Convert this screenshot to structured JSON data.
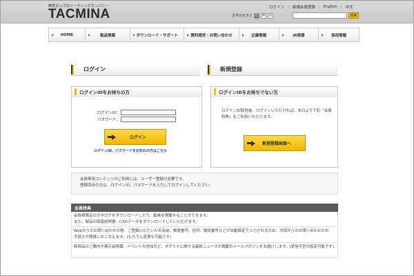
{
  "header": {
    "logo_sub": "精密ポンプのリーディングカンパニー",
    "logo": "TACMINA",
    "top_links": [
      "ログイン",
      "新規会員登録",
      "English",
      "中文"
    ],
    "font_size_label": "文字の大きさ",
    "font_sizes": [
      "小",
      "中",
      "大"
    ],
    "search_button": "検索"
  },
  "nav": [
    "HOME",
    "製品情報",
    "ダウンロード・サポート",
    "資料請求・お問い合わせ",
    "企業情報",
    "IR情報",
    "採用情報"
  ],
  "login": {
    "section_title": "ログイン",
    "panel_title": "ログインIDをお持ちの方",
    "id_label": "ログインID：",
    "password_label": "パスワード：",
    "button": "ログイン",
    "forgot": "ログインID、パスワードをお忘れの方はこちら"
  },
  "register": {
    "section_title": "新規登録",
    "panel_title": "ログインIDをお持ちでない方",
    "text": "ログインID取得後、ログインいただければ、本日より下記「会員特典」をご利用いただけます。",
    "button": "新規登録画面へ"
  },
  "info": {
    "line1": "会員専用コンテンツのご利用には、ユーザー登録が必要です。",
    "line2": "登録済みの方は、ログインID、パスワードを入力してログインしてください。"
  },
  "perks": {
    "title": "会員特典",
    "row1a": "会員様限定のカタログをダウンロードしたり、動画を視聴することができます。",
    "row1b": "また、製品の取扱説明書、CADデータをダウンロードしていただけます。",
    "row2a": "Webからのお問い合わせの際、ご登録いただいたお名前、郵便番号、住所、電話番号などが自動設定で入力されるため、次回からのお問い合わせのお",
    "row2b": "手続きが簡単におこなえます。(もちろん変更も可能です)",
    "row3": "新商品のご案内や展示会情報、イベントの告知など、タクミナに関する最新ニュースが満載のメールマガジンをお届けします。(受信可否の設定可能です)"
  }
}
